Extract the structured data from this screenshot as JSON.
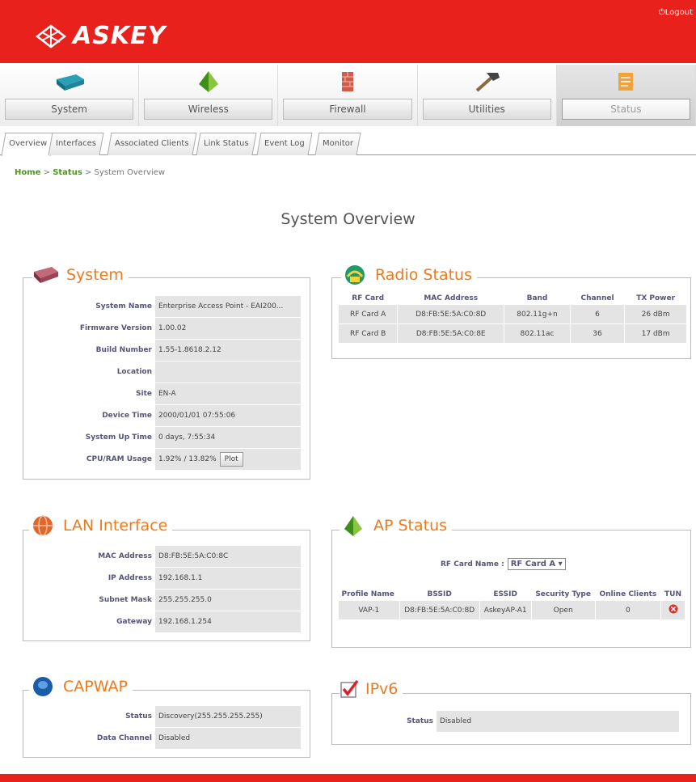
{
  "header": {
    "brand": "ASKEY",
    "logout": "Logout",
    "brand_color": "#e8211c"
  },
  "nav": {
    "items": [
      {
        "label": "System",
        "icon": "router-icon"
      },
      {
        "label": "Wireless",
        "icon": "pyramid-icon"
      },
      {
        "label": "Firewall",
        "icon": "firewall-icon"
      },
      {
        "label": "Utilities",
        "icon": "hammer-icon"
      },
      {
        "label": "Status",
        "icon": "notepad-icon"
      }
    ]
  },
  "tabs": [
    "Overview",
    "Interfaces",
    "Associated Clients",
    "Link Status",
    "Event Log",
    "Monitor"
  ],
  "breadcrumb": {
    "home": "Home",
    "sep1": " > ",
    "status": "Status",
    "sep2": " > ",
    "current": "System Overview"
  },
  "page_title": "System Overview",
  "system": {
    "title": "System",
    "rows": [
      {
        "label": "System Name",
        "value": "Enterprise Access Point - EAI200..."
      },
      {
        "label": "Firmware Version",
        "value": "1.00.02"
      },
      {
        "label": "Build Number",
        "value": "1.55-1.8618.2.12"
      },
      {
        "label": "Location",
        "value": ""
      },
      {
        "label": "Site",
        "value": "EN-A"
      },
      {
        "label": "Device Time",
        "value": "2000/01/01 07:55:06"
      },
      {
        "label": "System Up Time",
        "value": "0 days, 7:55:34"
      },
      {
        "label": "CPU/RAM Usage",
        "value": "1.92% / 13.82%"
      }
    ],
    "plot_button": "Plot"
  },
  "radio": {
    "title": "Radio Status",
    "headers": [
      "RF Card",
      "MAC Address",
      "Band",
      "Channel",
      "TX Power"
    ],
    "rows": [
      [
        "RF Card A",
        "D8:FB:5E:5A:C0:8D",
        "802.11g+n",
        "6",
        "26 dBm"
      ],
      [
        "RF Card B",
        "D8:FB:5E:5A:C0:8E",
        "802.11ac",
        "36",
        "17 dBm"
      ]
    ]
  },
  "lan": {
    "title": "LAN Interface",
    "rows": [
      {
        "label": "MAC Address",
        "value": "D8:FB:5E:5A:C0:8C"
      },
      {
        "label": "IP Address",
        "value": "192.168.1.1"
      },
      {
        "label": "Subnet Mask",
        "value": "255.255.255.0"
      },
      {
        "label": "Gateway",
        "value": "192.168.1.254"
      }
    ]
  },
  "ap": {
    "title": "AP Status",
    "rf_label": "RF Card Name :",
    "rf_value": "RF Card A",
    "headers": [
      "Profile Name",
      "BSSID",
      "ESSID",
      "Security Type",
      "Online Clients",
      "TUN"
    ],
    "rows": [
      [
        "VAP-1",
        "D8:FB:5E:5A:C0:8D",
        "AskeyAP-A1",
        "Open",
        "0"
      ]
    ]
  },
  "capwap": {
    "title": "CAPWAP",
    "rows": [
      {
        "label": "Status",
        "value": "Discovery(255.255.255.255)"
      },
      {
        "label": "Data Channel",
        "value": "Disabled"
      }
    ]
  },
  "ipv6": {
    "title": "IPv6",
    "rows": [
      {
        "label": "Status",
        "value": "Disabled"
      }
    ]
  }
}
